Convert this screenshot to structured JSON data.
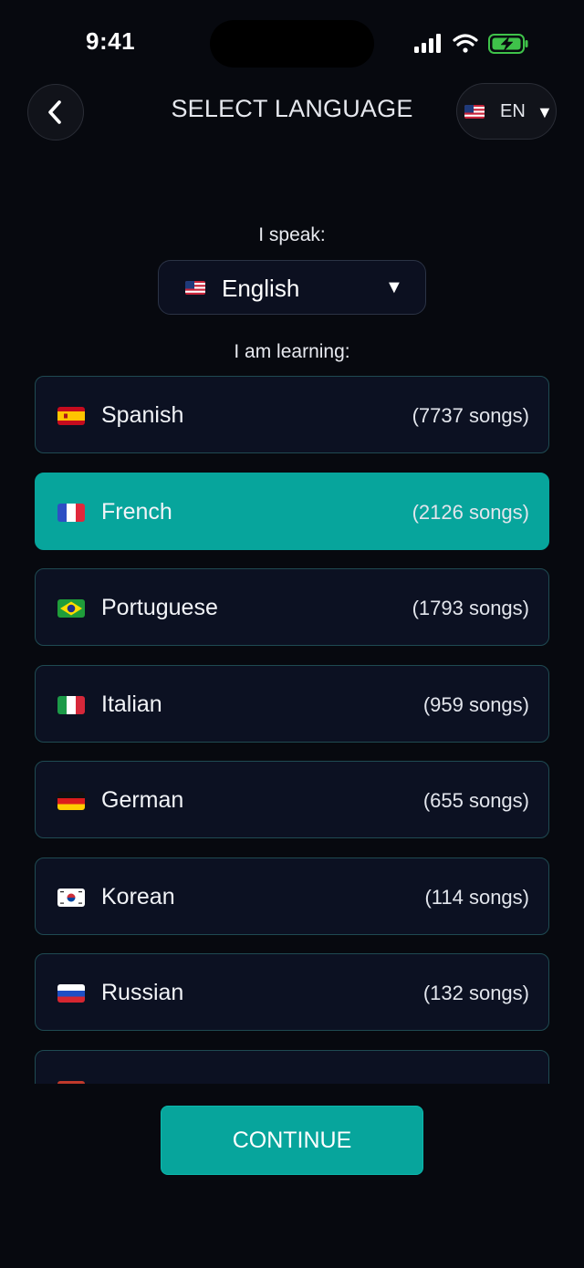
{
  "status_bar": {
    "time": "9:41"
  },
  "header": {
    "title": "SELECT LANGUAGE",
    "ui_language_code": "EN",
    "ui_language_flag": "us-flag-icon"
  },
  "speak": {
    "label": "I speak:",
    "value": "English",
    "flag": "us-flag-icon"
  },
  "learning": {
    "label": "I am learning:",
    "selected": "French",
    "items": [
      {
        "name": "Spanish",
        "count": "(7737 songs)",
        "flag": "es-flag-icon"
      },
      {
        "name": "French",
        "count": "(2126 songs)",
        "flag": "fr-flag-icon"
      },
      {
        "name": "Portuguese",
        "count": "(1793 songs)",
        "flag": "br-flag-icon"
      },
      {
        "name": "Italian",
        "count": "(959 songs)",
        "flag": "it-flag-icon"
      },
      {
        "name": "German",
        "count": "(655 songs)",
        "flag": "de-flag-icon"
      },
      {
        "name": "Korean",
        "count": "(114 songs)",
        "flag": "kr-flag-icon"
      },
      {
        "name": "Russian",
        "count": "(132 songs)",
        "flag": "ru-flag-icon"
      }
    ]
  },
  "continue_label": "CONTINUE",
  "colors": {
    "background": "#07090f",
    "accent": "#07a59c",
    "card": "#0c1122",
    "card_border": "#1f4a52"
  }
}
